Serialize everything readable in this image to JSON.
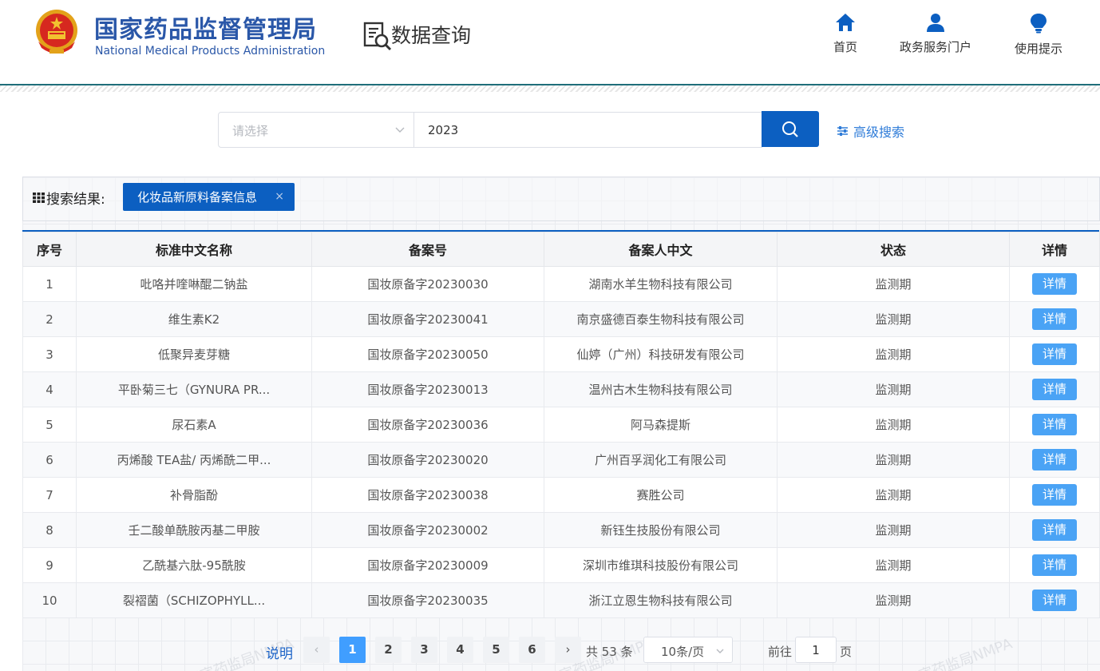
{
  "header": {
    "org_cn": "国家药品监督管理局",
    "org_en": "National Medical Products Administration",
    "section_title": "数据查询",
    "nav": [
      {
        "label": "首页",
        "icon": "home-icon"
      },
      {
        "label": "政务服务门户",
        "icon": "user-icon"
      },
      {
        "label": "使用提示",
        "icon": "lightbulb-icon"
      }
    ]
  },
  "search": {
    "select_placeholder": "请选择",
    "query": "2023",
    "advanced_label": "高级搜索"
  },
  "results": {
    "label": "搜索结果:",
    "tag": "化妆品新原料备案信息",
    "tag_close": "×"
  },
  "table": {
    "headers": [
      "序号",
      "标准中文名称",
      "备案号",
      "备案人中文",
      "状态",
      "详情"
    ],
    "detail_label": "详情",
    "rows": [
      {
        "no": "1",
        "name": "吡咯并喹啉醌二钠盐",
        "record": "国妆原备字20230030",
        "applicant": "湖南水羊生物科技有限公司",
        "status": "监测期"
      },
      {
        "no": "2",
        "name": "维生素K2",
        "record": "国妆原备字20230041",
        "applicant": "南京盛德百泰生物科技有限公司",
        "status": "监测期"
      },
      {
        "no": "3",
        "name": "低聚异麦芽糖",
        "record": "国妆原备字20230050",
        "applicant": "仙婷（广州）科技研发有限公司",
        "status": "监测期"
      },
      {
        "no": "4",
        "name": "平卧菊三七（GYNURA PR...",
        "record": "国妆原备字20230013",
        "applicant": "温州古木生物科技有限公司",
        "status": "监测期"
      },
      {
        "no": "5",
        "name": "尿石素A",
        "record": "国妆原备字20230036",
        "applicant": "阿马森提斯",
        "status": "监测期"
      },
      {
        "no": "6",
        "name": "丙烯酸 TEA盐/ 丙烯酰二甲...",
        "record": "国妆原备字20230020",
        "applicant": "广州百孚润化工有限公司",
        "status": "监测期"
      },
      {
        "no": "7",
        "name": "补骨脂酚",
        "record": "国妆原备字20230038",
        "applicant": "赛胜公司",
        "status": "监测期"
      },
      {
        "no": "8",
        "name": "壬二酸单酰胺丙基二甲胺",
        "record": "国妆原备字20230002",
        "applicant": "新钰生技股份有限公司",
        "status": "监测期"
      },
      {
        "no": "9",
        "name": "乙酰基六肽-95酰胺",
        "record": "国妆原备字20230009",
        "applicant": "深圳市维琪科技股份有限公司",
        "status": "监测期"
      },
      {
        "no": "10",
        "name": "裂褶菌（SCHIZOPHYLL...",
        "record": "国妆原备字20230035",
        "applicant": "浙江立恩生物科技有限公司",
        "status": "监测期"
      }
    ]
  },
  "pagination": {
    "explain": "说明",
    "prev": "‹",
    "next": "›",
    "pages": [
      "1",
      "2",
      "3",
      "4",
      "5",
      "6"
    ],
    "current": "1",
    "total": "共 53 条",
    "page_size": "10条/页",
    "goto_label": "前往",
    "goto_value": "1",
    "page_suffix": "页"
  },
  "watermark": "国家药监局NMPA",
  "colors": {
    "brand_blue": "#2a57a8",
    "primary": "#0c5fc1",
    "detail_button": "#4aa3f5",
    "active_page": "#409eff"
  }
}
